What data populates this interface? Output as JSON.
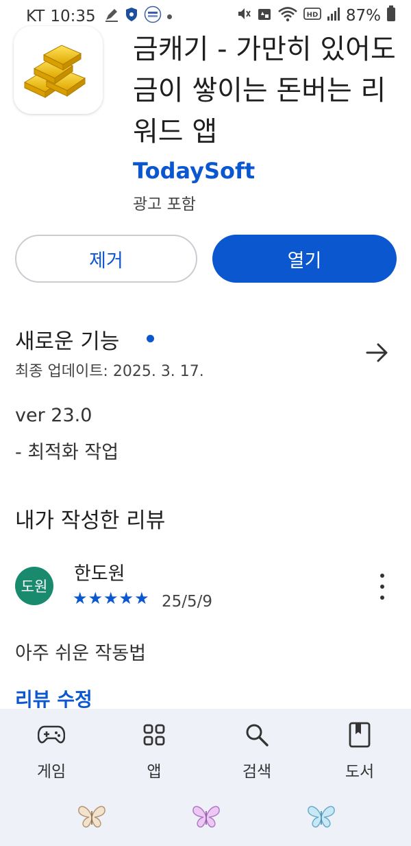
{
  "status_bar": {
    "carrier": "KT",
    "time": "10:35",
    "battery": "87%",
    "icons": [
      "pen-icon",
      "shield-icon",
      "badge-icon",
      "dot-icon",
      "mute-icon",
      "recycle-icon",
      "wifi-icon",
      "hd-icon",
      "signal-icon",
      "battery-icon"
    ]
  },
  "app": {
    "title": "금캐기 - 가만히 있어도 금이 쌓이는 돈버는 리워드 앱",
    "developer": "TodaySoft",
    "ad_note": "광고 포함",
    "icon": "gold-bars-icon"
  },
  "actions": {
    "uninstall_label": "제거",
    "open_label": "열기"
  },
  "whats_new": {
    "title": "새로운 기능",
    "updated": "최종 업데이트: 2025. 3. 17.",
    "version": "ver 23.0",
    "note": "- 최적화 작업"
  },
  "my_review": {
    "section_title": "내가 작성한 리뷰",
    "avatar_text": "도원",
    "reviewer": "한도원",
    "rating": 5,
    "max_rating": 5,
    "date": "25/5/9",
    "text": "아주 쉬운 작동법",
    "edit_label": "리뷰 수정"
  },
  "bottom_nav": {
    "items": [
      {
        "label": "게임",
        "icon": "gamepad-icon"
      },
      {
        "label": "앱",
        "icon": "apps-grid-icon"
      },
      {
        "label": "검색",
        "icon": "search-icon"
      },
      {
        "label": "도서",
        "icon": "book-icon"
      }
    ]
  },
  "decorations": [
    "butterfly-icon",
    "butterfly-icon",
    "butterfly-icon"
  ],
  "colors": {
    "accent": "#0b57d0",
    "avatar": "#198a6e",
    "nav_background": "#eef1f7"
  }
}
